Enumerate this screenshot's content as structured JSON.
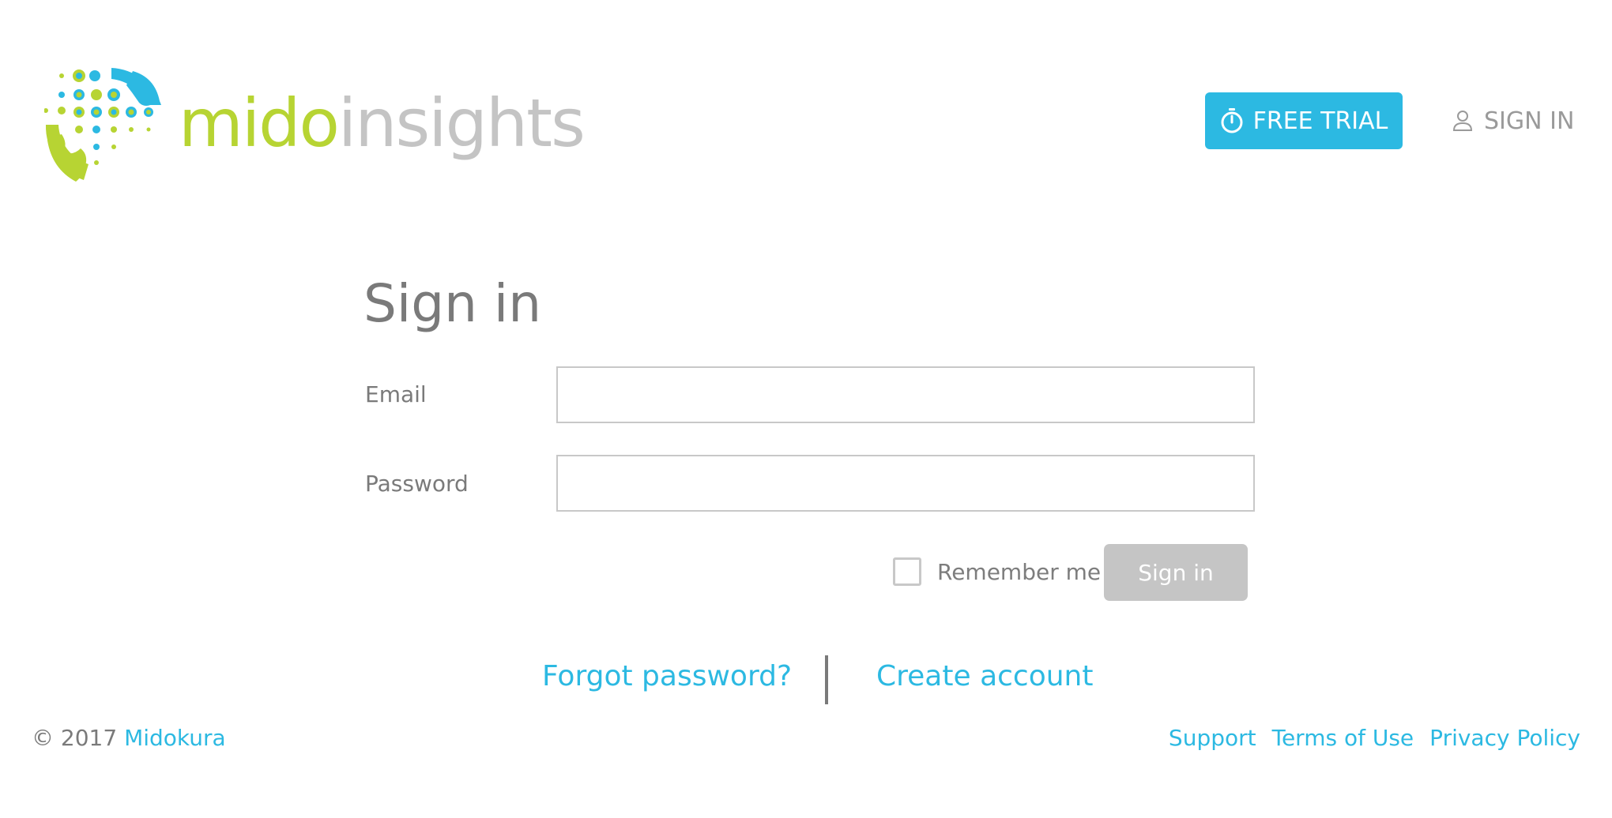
{
  "brand": {
    "logo_part_a": "mido",
    "logo_part_b": "insights",
    "colors": {
      "accent_blue": "#2cb9e2",
      "accent_green": "#b7d433",
      "gray_text": "#7a7a7a",
      "disabled_button": "#c5c5c5"
    }
  },
  "header": {
    "free_trial_label": "FREE TRIAL",
    "free_trial_icon": "stopwatch-icon",
    "sign_in_label": "SIGN IN",
    "sign_in_icon": "user-icon"
  },
  "form": {
    "title": "Sign in",
    "email_label": "Email",
    "email_value": "",
    "password_label": "Password",
    "password_value": "",
    "remember_label": "Remember me",
    "remember_checked": false,
    "submit_label": "Sign in"
  },
  "links": {
    "forgot": "Forgot password?",
    "create": "Create account"
  },
  "footer": {
    "copyright": "© 2017",
    "company": "Midokura",
    "support": "Support",
    "terms": "Terms of Use",
    "privacy": "Privacy Policy"
  }
}
